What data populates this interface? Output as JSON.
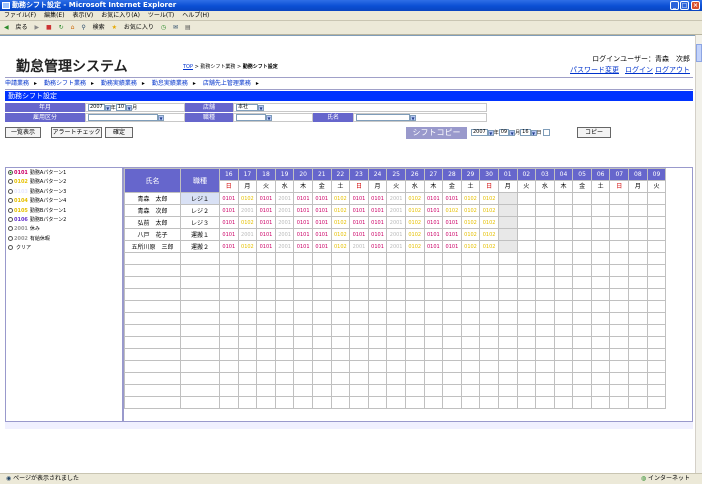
{
  "window": {
    "title": "勤務シフト設定 - Microsoft Internet Explorer"
  },
  "menubar": [
    "ファイル(F)",
    "編集(E)",
    "表示(V)",
    "お気に入り(A)",
    "ツール(T)",
    "ヘルプ(H)"
  ],
  "toolbar": [
    "戻る",
    "検索",
    "お気に入り"
  ],
  "app": {
    "title": "勤怠管理システム",
    "breadcrumb": {
      "top": "TOP",
      "sep1": " > 勤務シフト業務 > ",
      "current": "勤務シフト設定"
    },
    "user": {
      "label": "ログインユーザー：青森　次郎",
      "pw_change": "パスワード変更",
      "login": "ログイン",
      "logout": "ログアウト"
    }
  },
  "nav": [
    "申請業務",
    "勤務シフト業務",
    "勤務実績業務",
    "勤怠実績業務",
    "店舗先上管理業務"
  ],
  "header": "勤務シフト設定",
  "filters": {
    "ym_label": "年月",
    "year": "2007",
    "year_suffix": "年",
    "month": "10",
    "month_suffix": "月",
    "store_label": "店舗",
    "store_value": "本社",
    "emp_label": "雇用区分",
    "emp_value": "",
    "role_label": "職種",
    "role_value": "",
    "name_label": "氏名",
    "name_value": ""
  },
  "buttons": {
    "list": "一覧表示",
    "alert": "アラートチェック",
    "confirm": "確定",
    "copy_label": "シフトコピー",
    "copy": "コピー"
  },
  "copy_ctl": {
    "year": "2007",
    "y": "年",
    "month": "09",
    "m": "月",
    "day": "16",
    "d": "日"
  },
  "patterns": [
    {
      "code": "0101",
      "name": "勤務Aパターン1",
      "color": "#cc0066",
      "selected": true
    },
    {
      "code": "0102",
      "name": "勤務Aパターン2",
      "color": "#e6c000",
      "selected": false
    },
    {
      "code": "0103",
      "name": "勤務Aパターン3",
      "color": "#e8e8ff",
      "selected": false
    },
    {
      "code": "0104",
      "name": "勤務Aパターン4",
      "color": "#e6c000",
      "selected": false
    },
    {
      "code": "0105",
      "name": "勤務Bパターン1",
      "color": "#e6c000",
      "selected": false
    },
    {
      "code": "0106",
      "name": "勤務Bパターン2",
      "color": "#6633cc",
      "selected": false
    },
    {
      "code": "2001",
      "name": "休み",
      "color": "#999999",
      "selected": false
    },
    {
      "code": "2002",
      "name": "有給休暇",
      "color": "#999999",
      "selected": false
    },
    {
      "code": "",
      "name": "クリア",
      "color": "#000000",
      "selected": false
    }
  ],
  "grid": {
    "col_name": "氏名",
    "col_role": "職種",
    "days": [
      {
        "d": "16",
        "w": "日",
        "red": true
      },
      {
        "d": "17",
        "w": "月",
        "red": false
      },
      {
        "d": "18",
        "w": "火",
        "red": false
      },
      {
        "d": "19",
        "w": "水",
        "red": false
      },
      {
        "d": "20",
        "w": "木",
        "red": false
      },
      {
        "d": "21",
        "w": "金",
        "red": false
      },
      {
        "d": "22",
        "w": "土",
        "red": false
      },
      {
        "d": "23",
        "w": "日",
        "red": true
      },
      {
        "d": "24",
        "w": "月",
        "red": false
      },
      {
        "d": "25",
        "w": "火",
        "red": false
      },
      {
        "d": "26",
        "w": "水",
        "red": false
      },
      {
        "d": "27",
        "w": "木",
        "red": false
      },
      {
        "d": "28",
        "w": "金",
        "red": false
      },
      {
        "d": "29",
        "w": "土",
        "red": false
      },
      {
        "d": "30",
        "w": "日",
        "red": true
      },
      {
        "d": "01",
        "w": "月",
        "red": false
      },
      {
        "d": "02",
        "w": "火",
        "red": false
      },
      {
        "d": "03",
        "w": "水",
        "red": false
      },
      {
        "d": "04",
        "w": "木",
        "red": false
      },
      {
        "d": "05",
        "w": "金",
        "red": false
      },
      {
        "d": "06",
        "w": "土",
        "red": false
      },
      {
        "d": "07",
        "w": "日",
        "red": true
      },
      {
        "d": "08",
        "w": "月",
        "red": false
      },
      {
        "d": "09",
        "w": "火",
        "red": false
      }
    ],
    "rows": [
      {
        "name": "青森　太郎",
        "role": "レジ１",
        "hl": true,
        "cells": [
          "0101",
          "0102",
          "0101",
          "2001",
          "0101",
          "0101",
          "0102",
          "0101",
          "0101",
          "2001",
          "0102",
          "0101",
          "0101",
          "0102",
          "0102",
          "",
          "",
          "",
          "",
          "",
          "",
          "",
          "",
          ""
        ],
        "colors": [
          "#cc0066",
          "#e6c000",
          "#cc0066",
          "#bbbbbb",
          "#cc0066",
          "#cc0066",
          "#e6c000",
          "#cc0066",
          "#cc0066",
          "#bbbbbb",
          "#e6c000",
          "#cc0066",
          "#cc0066",
          "#e6c000",
          "#e6c000",
          "",
          "",
          "",
          "",
          "",
          "",
          "",
          "",
          ""
        ]
      },
      {
        "name": "青森　次郎",
        "role": "レジ２",
        "hl": false,
        "cells": [
          "0101",
          "2001",
          "0101",
          "2001",
          "0101",
          "0101",
          "0102",
          "0101",
          "0101",
          "2001",
          "0102",
          "0101",
          "0102",
          "0102",
          "0102",
          "",
          "",
          "",
          "",
          "",
          "",
          "",
          "",
          ""
        ],
        "colors": [
          "#cc0066",
          "#bbbbbb",
          "#cc0066",
          "#bbbbbb",
          "#cc0066",
          "#cc0066",
          "#e6c000",
          "#cc0066",
          "#cc0066",
          "#bbbbbb",
          "#e6c000",
          "#cc0066",
          "#e6c000",
          "#e6c000",
          "#e6c000",
          "",
          "",
          "",
          "",
          "",
          "",
          "",
          "",
          ""
        ]
      },
      {
        "name": "弘前　太郎",
        "role": "レジ３",
        "hl": false,
        "cells": [
          "0101",
          "0102",
          "0101",
          "2001",
          "0101",
          "0101",
          "0102",
          "0101",
          "0101",
          "2001",
          "0102",
          "0101",
          "0101",
          "0102",
          "0102",
          "",
          "",
          "",
          "",
          "",
          "",
          "",
          "",
          ""
        ],
        "colors": [
          "#cc0066",
          "#e6c000",
          "#cc0066",
          "#bbbbbb",
          "#cc0066",
          "#cc0066",
          "#e6c000",
          "#cc0066",
          "#cc0066",
          "#bbbbbb",
          "#e6c000",
          "#cc0066",
          "#cc0066",
          "#e6c000",
          "#e6c000",
          "",
          "",
          "",
          "",
          "",
          "",
          "",
          "",
          ""
        ]
      },
      {
        "name": "八戸　花子",
        "role": "運搬１",
        "hl": false,
        "cells": [
          "0101",
          "2001",
          "0101",
          "2001",
          "0101",
          "0101",
          "0102",
          "0101",
          "0101",
          "2001",
          "0102",
          "0101",
          "0101",
          "0102",
          "0102",
          "",
          "",
          "",
          "",
          "",
          "",
          "",
          "",
          ""
        ],
        "colors": [
          "#cc0066",
          "#bbbbbb",
          "#cc0066",
          "#bbbbbb",
          "#cc0066",
          "#cc0066",
          "#e6c000",
          "#cc0066",
          "#cc0066",
          "#bbbbbb",
          "#e6c000",
          "#cc0066",
          "#cc0066",
          "#e6c000",
          "#e6c000",
          "",
          "",
          "",
          "",
          "",
          "",
          "",
          "",
          ""
        ]
      },
      {
        "name": "五所川原　三郎",
        "role": "運搬２",
        "hl": false,
        "cells": [
          "0101",
          "0102",
          "0101",
          "2001",
          "0101",
          "0101",
          "0102",
          "2001",
          "0101",
          "2001",
          "0102",
          "0101",
          "0101",
          "0102",
          "0102",
          "",
          "",
          "",
          "",
          "",
          "",
          "",
          "",
          ""
        ],
        "colors": [
          "#cc0066",
          "#e6c000",
          "#cc0066",
          "#bbbbbb",
          "#cc0066",
          "#cc0066",
          "#e6c000",
          "#bbbbbb",
          "#cc0066",
          "#bbbbbb",
          "#e6c000",
          "#cc0066",
          "#cc0066",
          "#e6c000",
          "#e6c000",
          "",
          "",
          "",
          "",
          "",
          "",
          "",
          "",
          ""
        ]
      }
    ]
  },
  "status": {
    "left": "ページが表示されました",
    "zone": "インターネット"
  }
}
